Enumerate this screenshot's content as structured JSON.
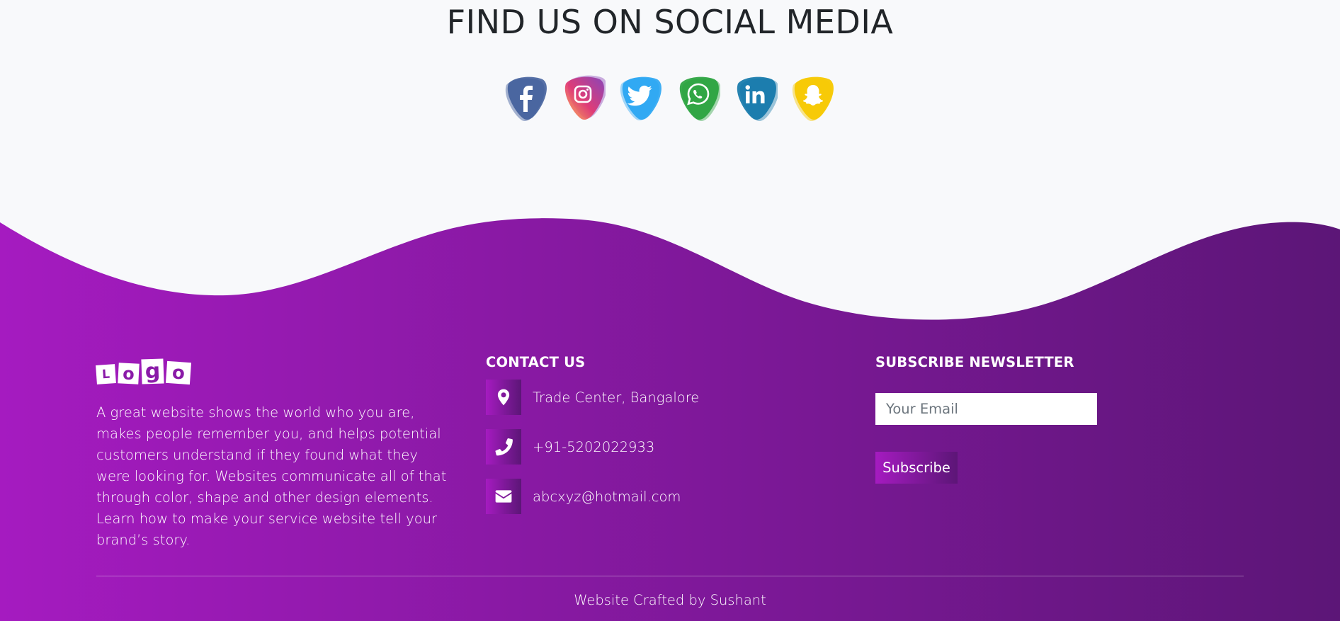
{
  "social": {
    "title": "FIND US ON SOCIAL MEDIA",
    "icons": [
      {
        "name": "facebook-icon",
        "color": "#3b5998"
      },
      {
        "name": "instagram-icon",
        "color": "#e1306c"
      },
      {
        "name": "twitter-icon",
        "color": "#1da1f2"
      },
      {
        "name": "whatsapp-icon",
        "color": "#25a13a"
      },
      {
        "name": "linkedin-icon",
        "color": "#0e76a8"
      },
      {
        "name": "snapchat-icon",
        "color": "#f7c800"
      }
    ]
  },
  "footer": {
    "gradient_start": "#a51bc0",
    "gradient_end": "#5c1677",
    "logo": {
      "letters": [
        "L",
        "o",
        "g",
        "o"
      ]
    },
    "about_text": "A great website shows the world who you are, makes people remember you, and helps potential customers understand if they found what they were looking for. Websites communicate all of that through color, shape and other design elements. Learn how to make your service website tell your brand’s story.",
    "contact": {
      "heading": "CONTACT US",
      "items": [
        {
          "icon": "location-pin-icon",
          "text": "Trade Center, Bangalore"
        },
        {
          "icon": "phone-icon",
          "text": "+91-5202022933"
        },
        {
          "icon": "envelope-icon",
          "text": "abcxyz@hotmail.com"
        }
      ]
    },
    "newsletter": {
      "heading": "SUBSCRIBE NEWSLETTER",
      "email_placeholder": "Your Email",
      "email_value": "",
      "button_label": "Subscribe"
    },
    "credit": "Website Crafted by Sushant"
  }
}
